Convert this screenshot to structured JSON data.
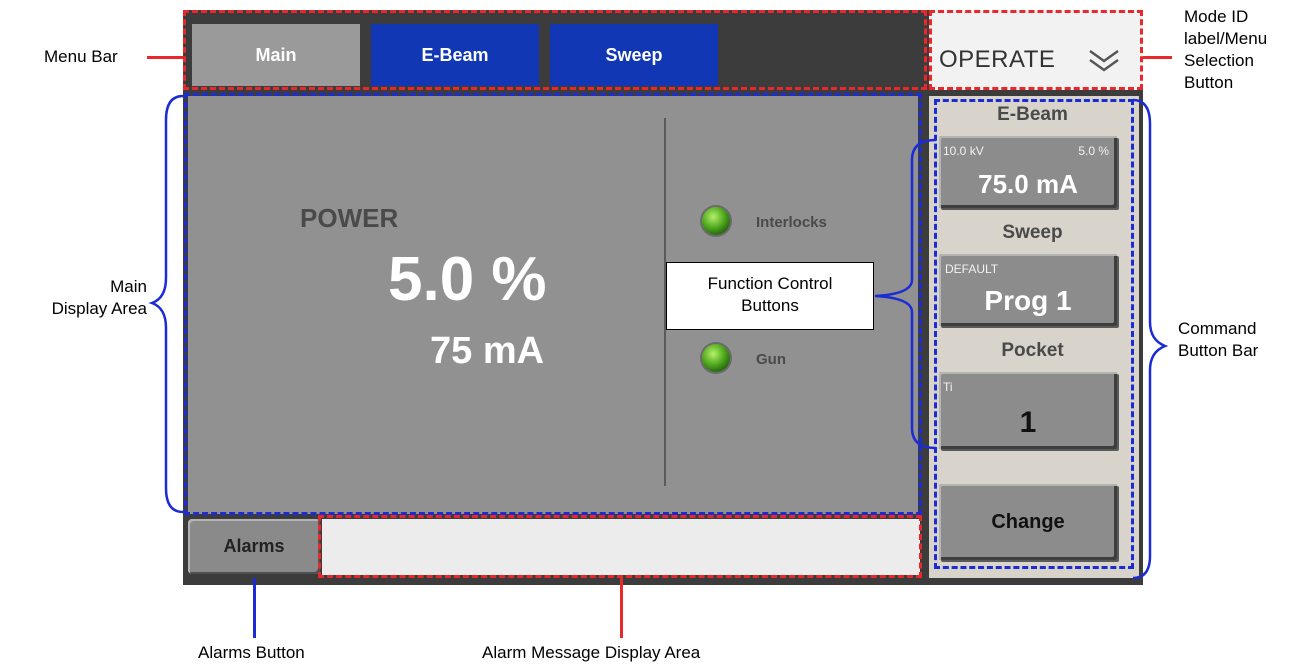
{
  "callouts": {
    "menu_bar": "Menu Bar",
    "mode_id": [
      "Mode ID",
      "label/Menu",
      "Selection",
      "Button"
    ],
    "main_display": [
      "Main",
      "Display Area"
    ],
    "function_control": [
      "Function Control",
      "Buttons"
    ],
    "command_bar": [
      "Command",
      "Button Bar"
    ],
    "alarms_button": "Alarms Button",
    "alarm_message": "Alarm Message Display Area"
  },
  "tabs": [
    "Main",
    "E-Beam",
    "Sweep"
  ],
  "mode_button": {
    "label": "OPERATE",
    "icon": "double-chevron-down-icon"
  },
  "main": {
    "power_label": "POWER",
    "power_percent": "5.0 %",
    "power_current": "75 mA",
    "indicators": [
      "Interlocks",
      "Gun"
    ]
  },
  "command_bar": {
    "ebeam": {
      "label": "E-Beam",
      "kv": "10.0 kV",
      "percent": "5.0 %",
      "value": "75.0 mA"
    },
    "sweep": {
      "label": "Sweep",
      "sub": "DEFAULT",
      "value": "Prog 1"
    },
    "pocket": {
      "label": "Pocket",
      "sub": "Ti",
      "value": "1"
    },
    "change": "Change"
  },
  "alarms_label": "Alarms",
  "colors": {
    "tab_active": "#9a9a9a",
    "tab_inactive": "#1237b4",
    "panel_bg": "#919191",
    "frame": "#3c3c3c",
    "led_green": "#4fa81e",
    "red_dash": "#e8282a",
    "blue_dash": "#1b2bd6"
  }
}
